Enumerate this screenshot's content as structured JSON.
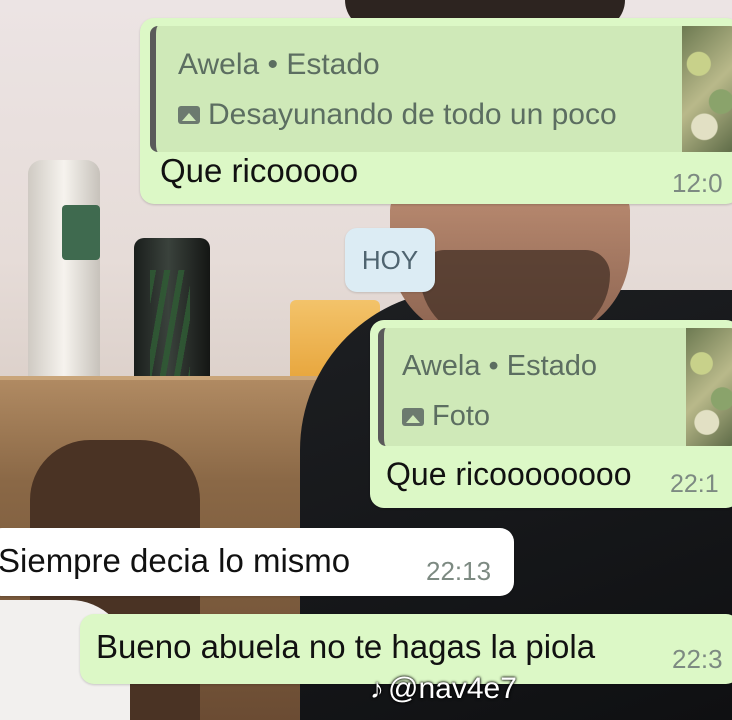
{
  "chat": {
    "messages": [
      {
        "quote_author": "Awela • Estado",
        "quote_text": "Desayunando de todo un poco",
        "text": "Que ricooooo",
        "time": "12:0"
      },
      {
        "quote_author": "Awela • Estado",
        "quote_text": "Foto",
        "text": "Que ricoooooooo",
        "time": "22:1"
      },
      {
        "text": "Siempre decia lo mismo",
        "time": "22:13"
      },
      {
        "text": "Bueno abuela no te hagas la piola",
        "time": "22:3"
      }
    ],
    "date_separator": "HOY"
  },
  "watermark": {
    "icon": "tiktok-icon",
    "handle": "@nav4e7"
  },
  "colors": {
    "outgoing_bubble": "#dcf8c6",
    "incoming_bubble": "#ffffff",
    "date_pill": "#dcecf4"
  }
}
